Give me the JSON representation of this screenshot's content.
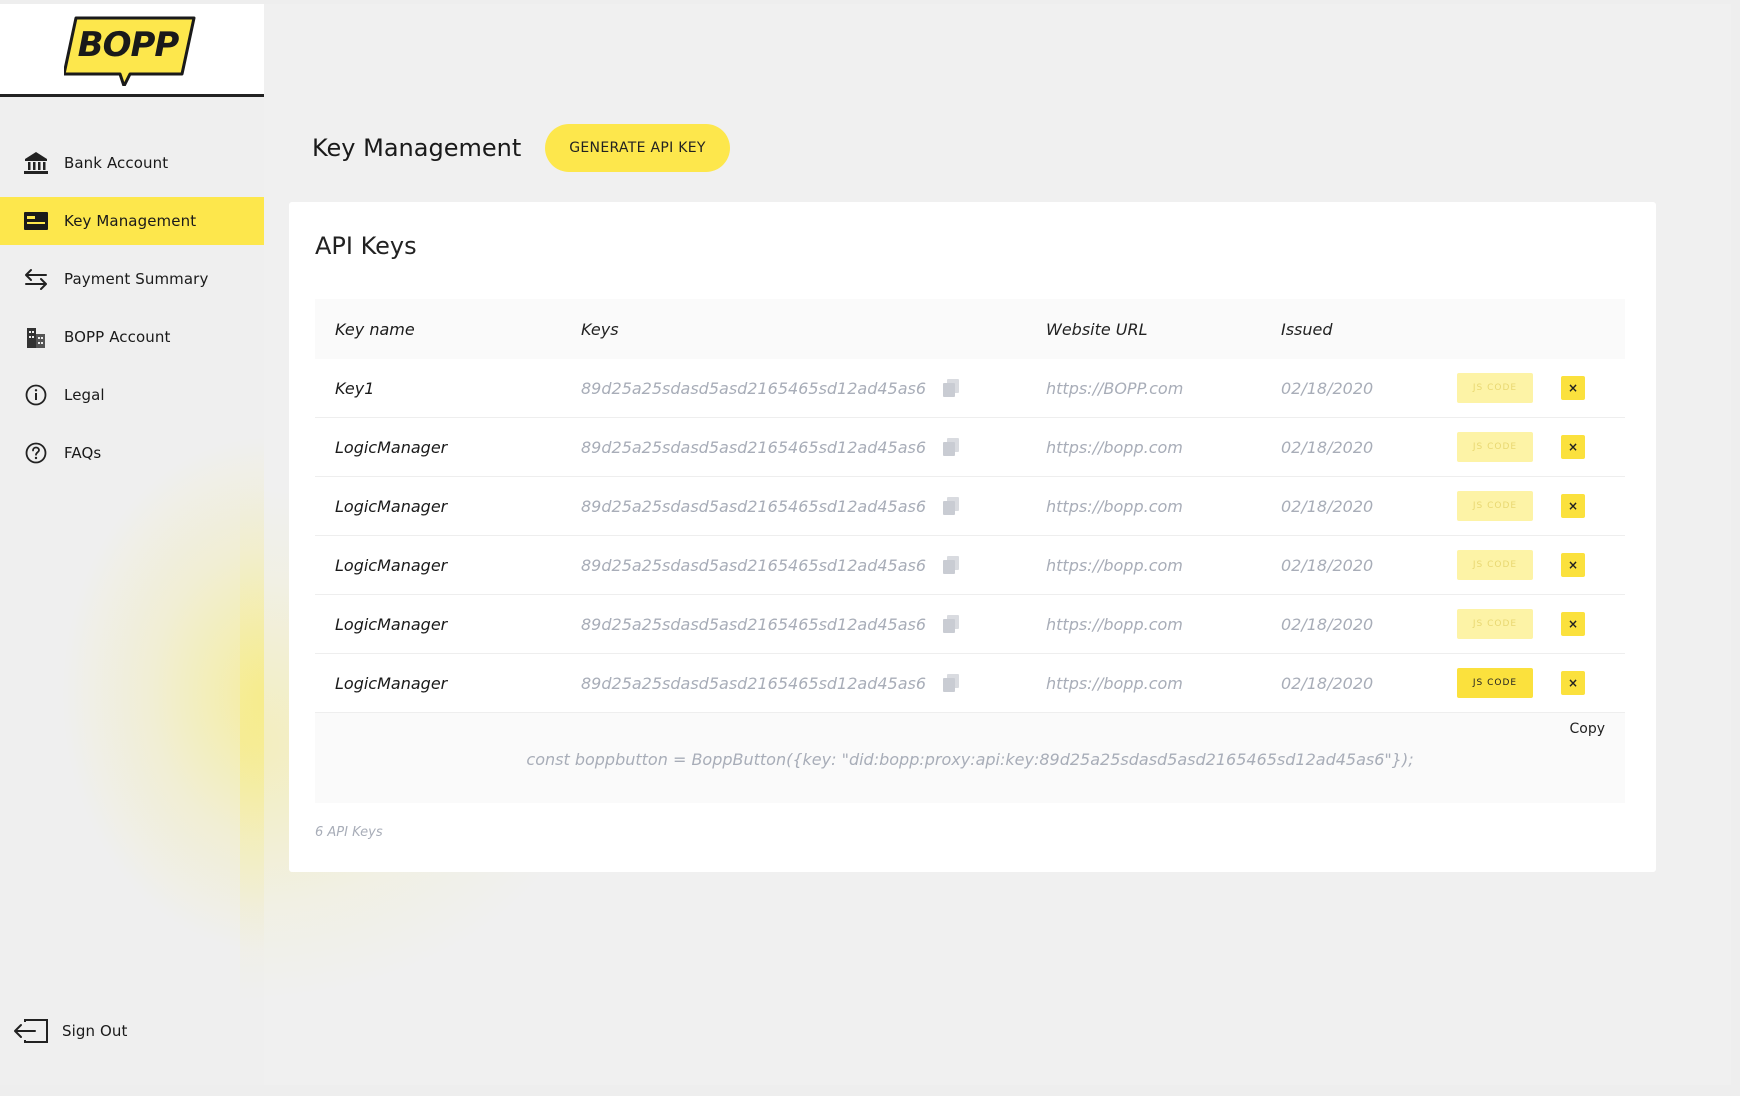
{
  "brand": {
    "logo_text": "BOPP",
    "accent": "#fde74c",
    "accent_strong": "#fbe13d"
  },
  "sidebar": {
    "items": [
      {
        "label": "Bank Account",
        "icon": "bank-icon",
        "active": false
      },
      {
        "label": "Key Management",
        "icon": "card-icon",
        "active": true
      },
      {
        "label": "Payment Summary",
        "icon": "transfer-arrows-icon",
        "active": false
      },
      {
        "label": "BOPP Account",
        "icon": "building-icon",
        "active": false
      },
      {
        "label": "Legal",
        "icon": "info-icon",
        "active": false
      },
      {
        "label": "FAQs",
        "icon": "question-icon",
        "active": false
      }
    ],
    "signout_label": "Sign Out"
  },
  "header": {
    "title": "Key Management",
    "generate_label": "GENERATE API KEY"
  },
  "card": {
    "title": "API Keys",
    "columns": [
      "Key name",
      "Keys",
      "Website URL",
      "Issued"
    ],
    "rows": [
      {
        "name": "Key1",
        "key": "89d25a25sdasd5asd2165465sd12ad45as6",
        "url": "https://BOPP.com",
        "issued": "02/18/2020",
        "js_label": "JS CODE",
        "js_active": false,
        "delete_label": "×"
      },
      {
        "name": "LogicManager",
        "key": "89d25a25sdasd5asd2165465sd12ad45as6",
        "url": "https://bopp.com",
        "issued": "02/18/2020",
        "js_label": "JS CODE",
        "js_active": false,
        "delete_label": "×"
      },
      {
        "name": "LogicManager",
        "key": "89d25a25sdasd5asd2165465sd12ad45as6",
        "url": "https://bopp.com",
        "issued": "02/18/2020",
        "js_label": "JS CODE",
        "js_active": false,
        "delete_label": "×"
      },
      {
        "name": "LogicManager",
        "key": "89d25a25sdasd5asd2165465sd12ad45as6",
        "url": "https://bopp.com",
        "issued": "02/18/2020",
        "js_label": "JS CODE",
        "js_active": false,
        "delete_label": "×"
      },
      {
        "name": "LogicManager",
        "key": "89d25a25sdasd5asd2165465sd12ad45as6",
        "url": "https://bopp.com",
        "issued": "02/18/2020",
        "js_label": "JS CODE",
        "js_active": false,
        "delete_label": "×"
      },
      {
        "name": "LogicManager",
        "key": "89d25a25sdasd5asd2165465sd12ad45as6",
        "url": "https://bopp.com",
        "issued": "02/18/2020",
        "js_label": "JS CODE",
        "js_active": true,
        "delete_label": "×"
      }
    ],
    "code": {
      "copy_label": "Copy",
      "snippet": "const boppbutton = BoppButton({key: \"did:bopp:proxy:api:key:89d25a25sdasd5asd2165465sd12ad45as6\"});"
    },
    "count_label": "6 API Keys"
  }
}
